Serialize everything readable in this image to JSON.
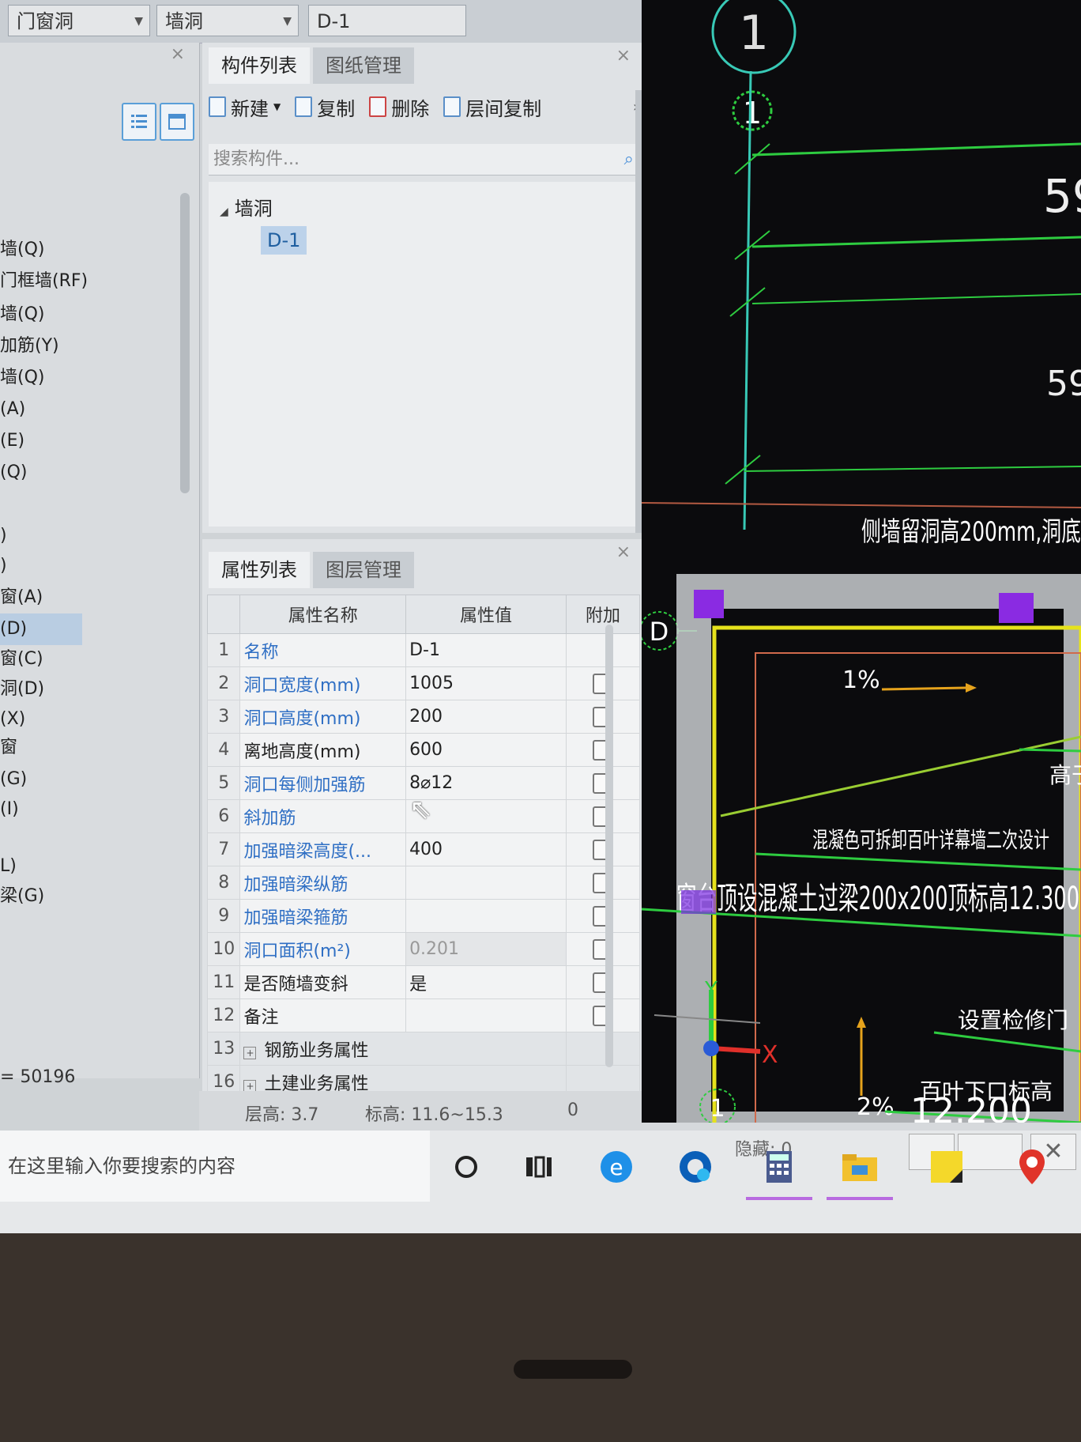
{
  "topbar": {
    "combo1": "门窗洞",
    "combo2": "墙洞",
    "combo3": "D-1"
  },
  "left_nav": {
    "items": [
      {
        "label": "墙(Q)"
      },
      {
        "label": "门框墙(RF)"
      },
      {
        "label": "墙(Q)"
      },
      {
        "label": "加筋(Y)"
      },
      {
        "label": "墙(Q)"
      },
      {
        "label": "(A)"
      },
      {
        "label": "(E)"
      },
      {
        "label": "(Q)"
      },
      {
        "label": ")"
      },
      {
        "label": ")"
      },
      {
        "label": "窗(A)"
      },
      {
        "label": "(D)"
      },
      {
        "label": "窗(C)"
      },
      {
        "label": "洞(D)"
      },
      {
        "label": "(X)"
      },
      {
        "label": "窗"
      },
      {
        "label": "(G)"
      },
      {
        "label": "(I)"
      },
      {
        "label": "L)"
      },
      {
        "label": "梁(G)"
      }
    ],
    "count_text": "= 50196"
  },
  "component_panel": {
    "tabs": [
      "构件列表",
      "图纸管理"
    ],
    "toolbar": {
      "new": "新建",
      "copy": "复制",
      "delete": "删除",
      "layer_copy": "层间复制"
    },
    "search_placeholder": "搜索构件...",
    "tree_root": "墙洞",
    "tree_leaf": "D-1"
  },
  "property_panel": {
    "tabs": [
      "属性列表",
      "图层管理"
    ],
    "headers": {
      "name": "属性名称",
      "value": "属性值",
      "extra": "附加"
    },
    "rows": [
      {
        "num": "1",
        "name": "名称",
        "value": "D-1"
      },
      {
        "num": "2",
        "name": "洞口宽度(mm)",
        "value": "1005"
      },
      {
        "num": "3",
        "name": "洞口高度(mm)",
        "value": "200"
      },
      {
        "num": "4",
        "name": "离地高度(mm)",
        "value": "600"
      },
      {
        "num": "5",
        "name": "洞口每侧加强筋",
        "value": "8⌀12"
      },
      {
        "num": "6",
        "name": "斜加筋",
        "value": ""
      },
      {
        "num": "7",
        "name": "加强暗梁高度(...",
        "value": "400"
      },
      {
        "num": "8",
        "name": "加强暗梁纵筋",
        "value": ""
      },
      {
        "num": "9",
        "name": "加强暗梁箍筋",
        "value": ""
      },
      {
        "num": "10",
        "name": "洞口面积(m²)",
        "value": "0.201"
      },
      {
        "num": "11",
        "name": "是否随墙变斜",
        "value": "是"
      },
      {
        "num": "12",
        "name": "备注",
        "value": ""
      }
    ],
    "groups": [
      {
        "num": "13",
        "name": "钢筋业务属性"
      },
      {
        "num": "16",
        "name": "土建业务属性"
      }
    ]
  },
  "statusbar": {
    "floor_height": "层高: 3.7",
    "elevation": "标高: 11.6~15.3",
    "zero": "0",
    "hidden": "隐藏: 0"
  },
  "cad": {
    "axis_top": "1",
    "axis_second": "1",
    "axis_d": "D",
    "dim1": "59",
    "dim2": "59",
    "note_top": "侧墙留洞高200mm,洞底",
    "slope_top": "1%",
    "note_right": "高于",
    "louver_note": "混凝色可拆卸百叶详幕墙二次设计",
    "beam_note": "窗台顶设混凝土过梁200x200顶标高12.300",
    "access_door": "设置检修门",
    "louver_bottom": "百叶下口标高",
    "slope_bottom": "2%",
    "elev_value": "12.200",
    "axis_x": "X",
    "axis_y": "Y",
    "axis_bottom": "1"
  },
  "taskbar": {
    "search_placeholder": "在这里输入你要搜索的内容",
    "icons": [
      "cortana-icon",
      "task-view-icon",
      "edge-icon",
      "edge-beta-icon",
      "calculator-icon",
      "file-explorer-icon",
      "sticky-notes-icon",
      "maps-icon"
    ]
  },
  "colors": {
    "cad_bg": "#0b0b0d",
    "cad_green": "#2ecc40",
    "cad_yellow": "#e6e21c",
    "cad_purple": "#8a2be2",
    "link_blue": "#2f6fc4",
    "selected_bg": "#bcd2ea"
  }
}
